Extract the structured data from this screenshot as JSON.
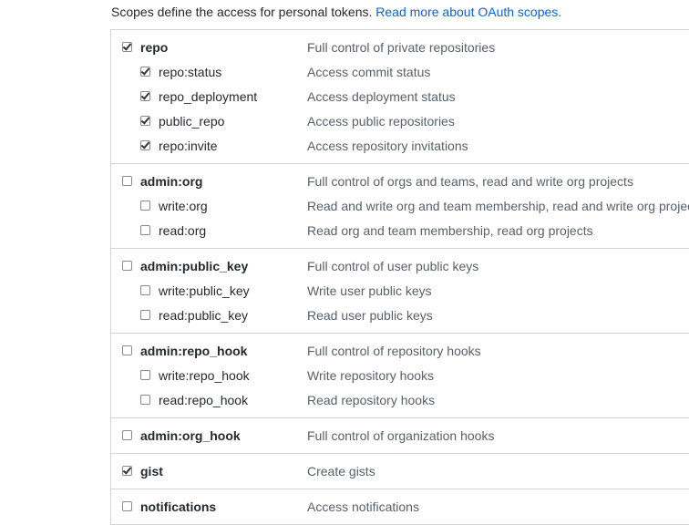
{
  "intro": {
    "text": "Scopes define the access for personal tokens. ",
    "link": "Read more about OAuth scopes."
  },
  "groups": [
    {
      "parent": {
        "label": "repo",
        "desc": "Full control of private repositories",
        "checked": true
      },
      "children": [
        {
          "label": "repo:status",
          "desc": "Access commit status",
          "checked": true
        },
        {
          "label": "repo_deployment",
          "desc": "Access deployment status",
          "checked": true
        },
        {
          "label": "public_repo",
          "desc": "Access public repositories",
          "checked": true
        },
        {
          "label": "repo:invite",
          "desc": "Access repository invitations",
          "checked": true
        }
      ]
    },
    {
      "parent": {
        "label": "admin:org",
        "desc": "Full control of orgs and teams, read and write org projects",
        "checked": false
      },
      "children": [
        {
          "label": "write:org",
          "desc": "Read and write org and team membership, read and write org projects",
          "checked": false
        },
        {
          "label": "read:org",
          "desc": "Read org and team membership, read org projects",
          "checked": false
        }
      ]
    },
    {
      "parent": {
        "label": "admin:public_key",
        "desc": "Full control of user public keys",
        "checked": false
      },
      "children": [
        {
          "label": "write:public_key",
          "desc": "Write user public keys",
          "checked": false
        },
        {
          "label": "read:public_key",
          "desc": "Read user public keys",
          "checked": false
        }
      ]
    },
    {
      "parent": {
        "label": "admin:repo_hook",
        "desc": "Full control of repository hooks",
        "checked": false
      },
      "children": [
        {
          "label": "write:repo_hook",
          "desc": "Write repository hooks",
          "checked": false
        },
        {
          "label": "read:repo_hook",
          "desc": "Read repository hooks",
          "checked": false
        }
      ]
    },
    {
      "parent": {
        "label": "admin:org_hook",
        "desc": "Full control of organization hooks",
        "checked": false
      },
      "children": []
    },
    {
      "parent": {
        "label": "gist",
        "desc": "Create gists",
        "checked": true
      },
      "children": []
    },
    {
      "parent": {
        "label": "notifications",
        "desc": "Access notifications",
        "checked": false
      },
      "children": []
    }
  ]
}
